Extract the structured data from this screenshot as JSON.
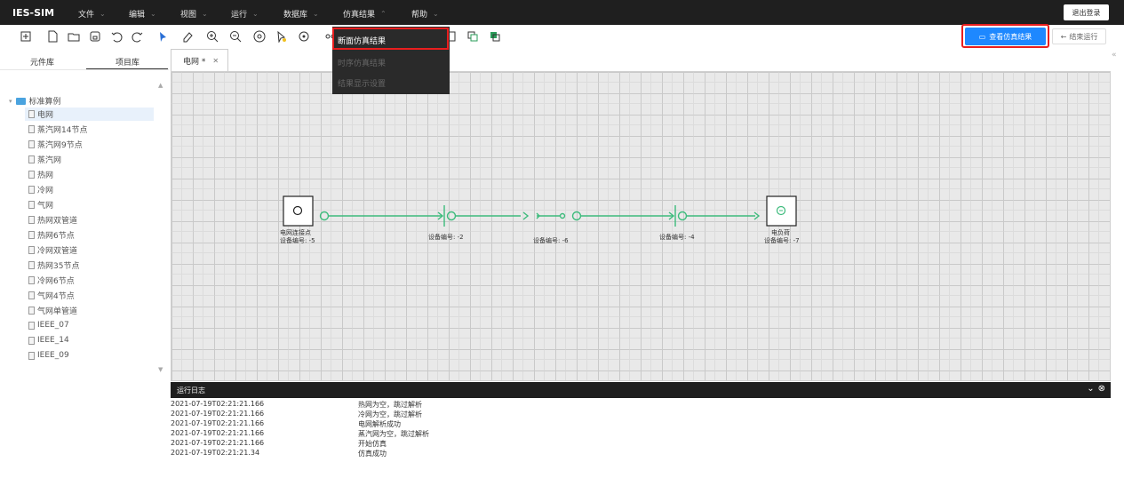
{
  "app": {
    "name": "IES-SIM",
    "logout": "退出登录"
  },
  "menu": [
    {
      "label": "文件"
    },
    {
      "label": "编辑"
    },
    {
      "label": "视图"
    },
    {
      "label": "运行"
    },
    {
      "label": "数据库"
    },
    {
      "label": "仿真结果"
    },
    {
      "label": "帮助"
    }
  ],
  "dropdown": {
    "items": [
      {
        "label": "断面仿真结果",
        "enabled": true
      },
      {
        "label": "时序仿真结果",
        "enabled": false
      },
      {
        "label": "结果显示设置",
        "enabled": false
      }
    ]
  },
  "toolbar": {
    "view_results": "查看仿真结果",
    "end_run": "结束运行",
    "icons": [
      "new-icon",
      "new-file-icon",
      "open-folder-icon",
      "save-icon",
      "undo-icon",
      "redo-icon",
      "pointer-icon",
      "eraser-icon",
      "zoom-in-icon",
      "zoom-out-icon",
      "zoom-fit-icon",
      "select-icon",
      "target-icon",
      "link-icon",
      "box-icon",
      "copy-icon",
      "layer-icon"
    ]
  },
  "sidebar": {
    "tabs": [
      "元件库",
      "项目库"
    ],
    "root": "标准算例",
    "items": [
      "电网",
      "蒸汽网14节点",
      "蒸汽网9节点",
      "蒸汽网",
      "热网",
      "冷网",
      "气网",
      "热网双管道",
      "热网6节点",
      "冷网双管道",
      "热网35节点",
      "冷网6节点",
      "气网4节点",
      "气网单管道",
      "IEEE_07",
      "IEEE_14",
      "IEEE_09"
    ]
  },
  "editor": {
    "tab": "电网 *",
    "labels": {
      "source_name": "电网连接点",
      "source_id": "设备编号: -5",
      "dev2": "设备编号: -2",
      "dev6": "设备编号: -6",
      "dev4": "设备编号: -4",
      "load_name": "电负荷",
      "load_id": "设备编号: -7"
    }
  },
  "log": {
    "title": "运行日志",
    "entries": [
      {
        "time": "2021-07-19T02:21:21.166",
        "msg": "热网为空，跳过解析"
      },
      {
        "time": "2021-07-19T02:21:21.166",
        "msg": "冷网为空，跳过解析"
      },
      {
        "time": "2021-07-19T02:21:21.166",
        "msg": "电网解析成功"
      },
      {
        "time": "2021-07-19T02:21:21.166",
        "msg": "蒸汽网为空，跳过解析"
      },
      {
        "time": "2021-07-19T02:21:21.166",
        "msg": "开始仿真"
      },
      {
        "time": "2021-07-19T02:21:21.34",
        "msg": "仿真成功"
      }
    ]
  },
  "colors": {
    "accent": "#1e88ff",
    "highlight": "#e81e1e",
    "line": "#3dbb7c"
  }
}
